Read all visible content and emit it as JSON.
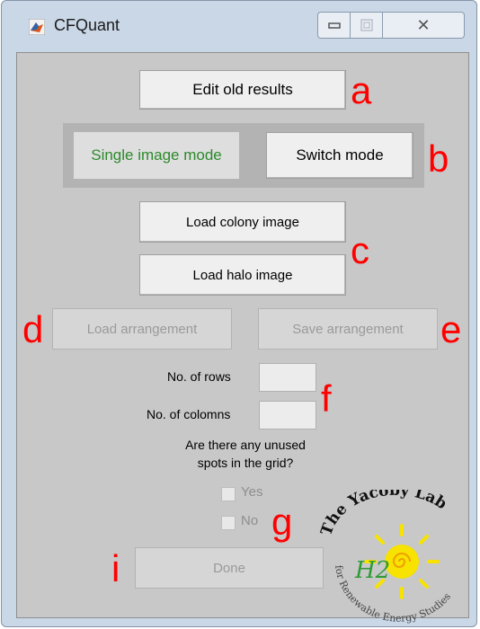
{
  "window": {
    "title": "CFQuant",
    "close_glyph": "✕",
    "minimize_glyph": "▭",
    "maximize_glyph": "▢"
  },
  "buttons": {
    "edit_old_results": "Edit old results",
    "switch_mode": "Switch mode",
    "load_colony_image": "Load colony image",
    "load_halo_image": "Load halo image",
    "load_arrangement": "Load arrangement",
    "save_arrangement": "Save arrangement",
    "done": "Done"
  },
  "mode_label": "Single image mode",
  "grid": {
    "rows_label": "No. of rows",
    "columns_label": "No. of colomns",
    "rows_value": "",
    "columns_value": ""
  },
  "question": {
    "line1": "Are there any unused",
    "line2": "spots in the grid?"
  },
  "options": {
    "yes": "Yes",
    "no": "No",
    "yes_checked": false,
    "no_checked": false
  },
  "annotations": {
    "a": "a",
    "b": "b",
    "c": "c",
    "d": "d",
    "e": "e",
    "f": "f",
    "g": "g",
    "i": "i"
  },
  "logo": {
    "name": "The Yacoby Lab",
    "subtitle": "for Renewable Energy Studies",
    "h2": "H2"
  },
  "colors": {
    "mode_text": "#2c8a2c",
    "annotation": "#ff0000",
    "sun": "#f7e200"
  }
}
